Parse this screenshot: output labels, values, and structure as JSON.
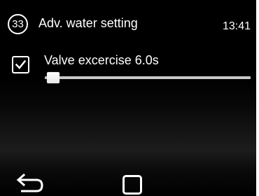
{
  "header": {
    "screen_number": "33",
    "title": "Adv. water setting",
    "time": "13:41"
  },
  "setting": {
    "checked": true,
    "label": "Valve excercise 6.0s",
    "slider_level": 0.0
  },
  "nav": {
    "back_icon": "back-arrow-icon",
    "home_icon": "home-square-icon"
  },
  "colors": {
    "background": "#000000",
    "foreground": "#ffffff",
    "slider_track": "#c8c8c8"
  }
}
